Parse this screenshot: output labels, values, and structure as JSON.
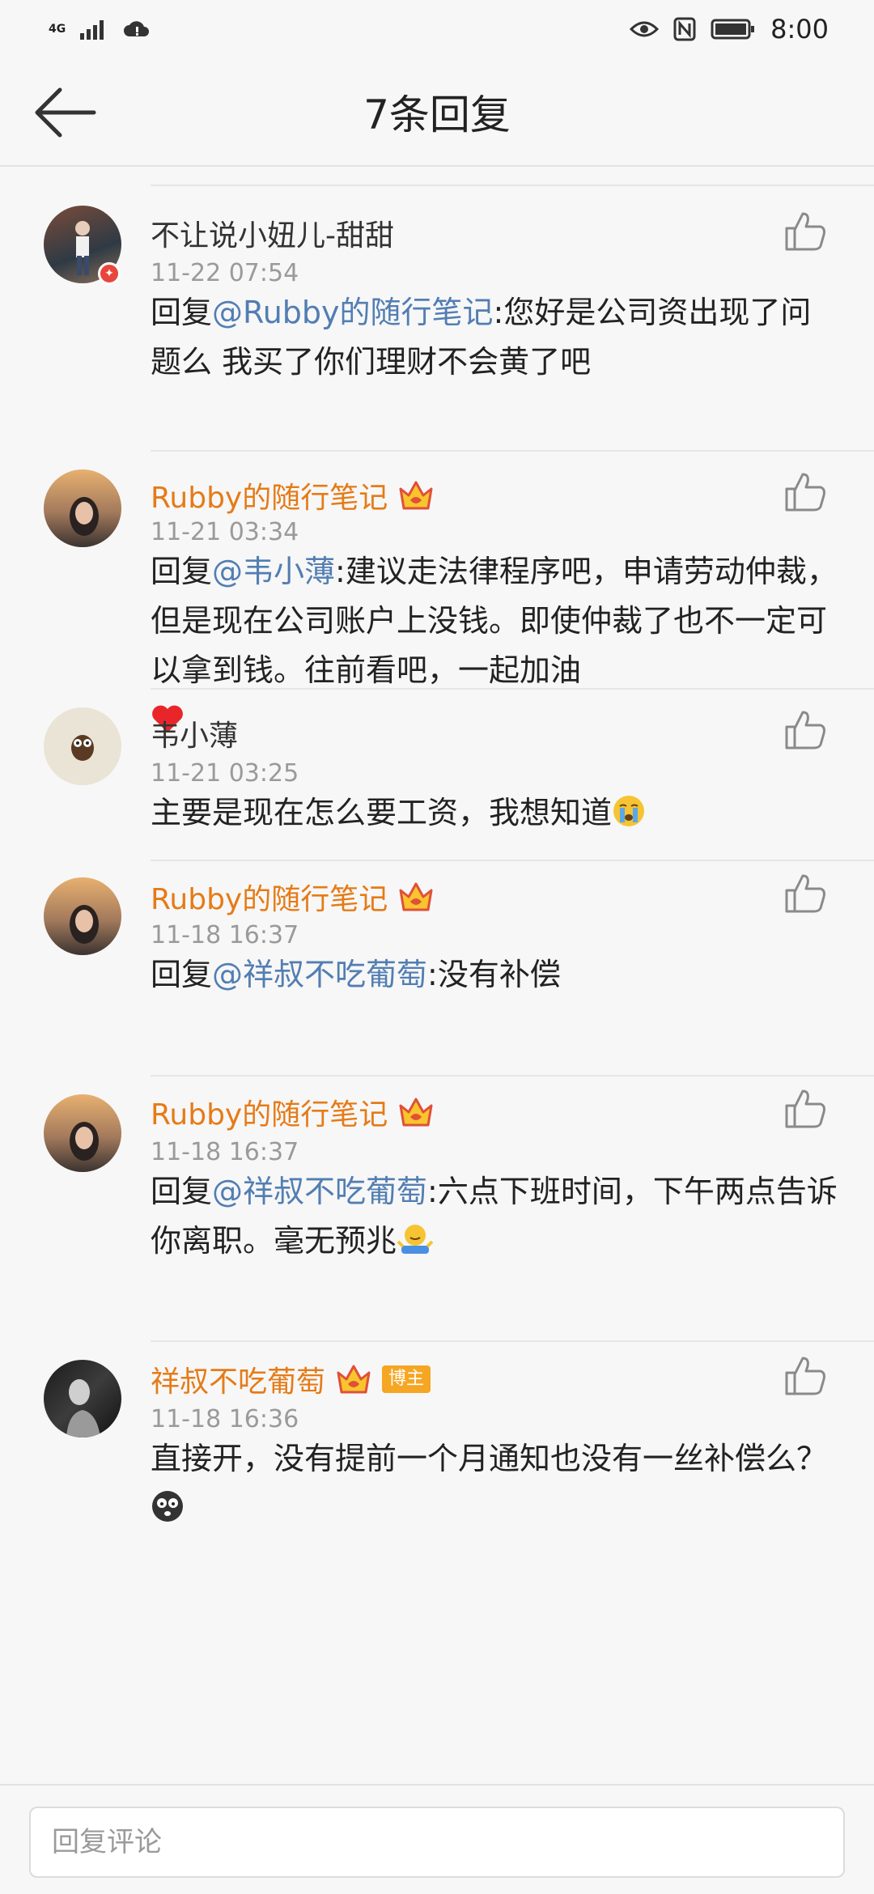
{
  "status_bar": {
    "network": "4G",
    "time": "8:00"
  },
  "header": {
    "title": "7条回复"
  },
  "comments": [
    {
      "name": "不让说小妞儿-甜甜",
      "time": "11-22 07:54",
      "prefix": "回复",
      "mention": "@Rubby的随行笔记",
      "text": ":您好是公司资出现了问题么 我买了你们理财不会黄了吧"
    },
    {
      "name": "Rubby的随行笔记",
      "time": "11-21 03:34",
      "prefix": "回复",
      "mention": "@韦小薄",
      "text": ":建议走法律程序吧，申请劳动仲裁，但是现在公司账户上没钱。即使仲裁了也不一定可以拿到钱。往前看吧，一起加油",
      "emoji": "heart-emoji"
    },
    {
      "name": "韦小薄",
      "time": "11-21 03:25",
      "text": "主要是现在怎么要工资，我想知道",
      "emoji": "crying-emoji"
    },
    {
      "name": "Rubby的随行笔记",
      "time": "11-18 16:37",
      "prefix": "回复",
      "mention": "@祥叔不吃葡萄",
      "text": ":没有补偿"
    },
    {
      "name": "Rubby的随行笔记",
      "time": "11-18 16:37",
      "prefix": "回复",
      "mention": "@祥叔不吃葡萄",
      "text": ":六点下班时间，下午两点告诉你离职。毫无预兆",
      "emoji": "shrug-emoji"
    },
    {
      "name": "祥叔不吃葡萄",
      "badge": "博主",
      "time": "11-18 16:36",
      "text": "直接开，没有提前一个月通知也没有一丝补偿么？",
      "emoji": "shocked-emoji"
    }
  ],
  "reply_box": {
    "placeholder": "回复评论"
  },
  "colors": {
    "vip_name": "#e57b17",
    "mention": "#527eb2",
    "timestamp": "#9a9a9a",
    "background": "#f7f7f7"
  }
}
